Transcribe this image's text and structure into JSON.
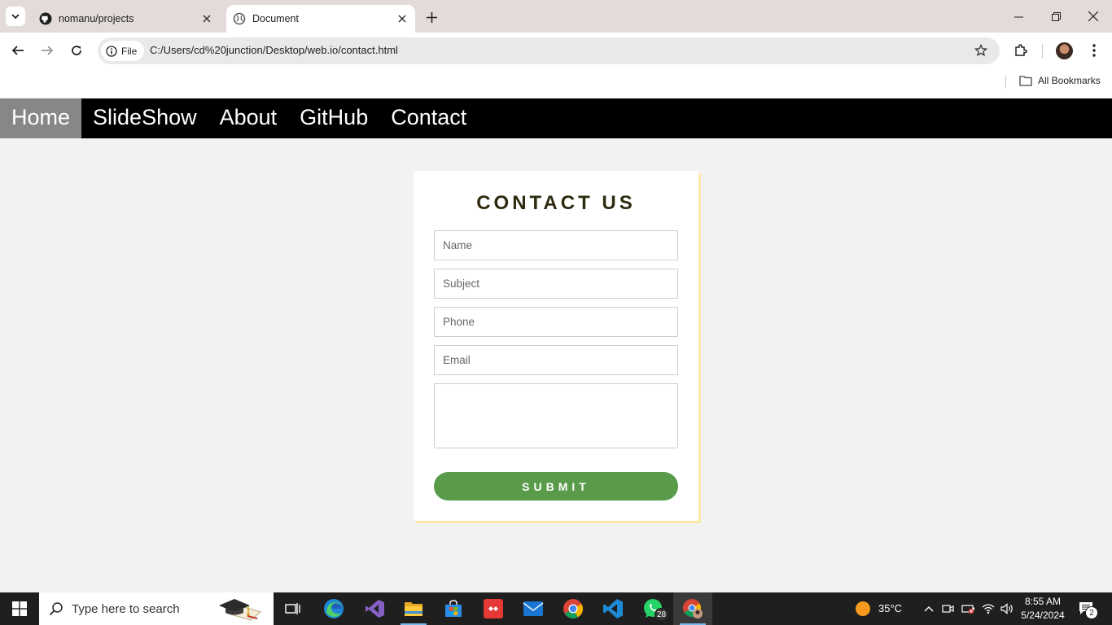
{
  "browser": {
    "tabs": [
      {
        "title": "nomanu/projects",
        "active": false
      },
      {
        "title": "Document",
        "active": true
      }
    ],
    "address": {
      "chip_label": "File",
      "url": "C:/Users/cd%20junction/Desktop/web.io/contact.html"
    },
    "bookmarks": {
      "all_label": "All Bookmarks"
    }
  },
  "site": {
    "nav": [
      {
        "label": "Home",
        "active": true
      },
      {
        "label": "SlideShow",
        "active": false
      },
      {
        "label": "About",
        "active": false
      },
      {
        "label": "GitHub",
        "active": false
      },
      {
        "label": "Contact",
        "active": false
      }
    ],
    "contact": {
      "title": "CONTACT US",
      "fields": {
        "name_placeholder": "Name",
        "subject_placeholder": "Subject",
        "phone_placeholder": "Phone",
        "email_placeholder": "Email",
        "message_value": ""
      },
      "submit_label": "SUBMIT"
    },
    "colors": {
      "nav_bg": "#000000",
      "nav_active": "#878787",
      "submit_bg": "#599b4b",
      "card_shadow": "#fbe9a8",
      "title_color": "#2e2a10"
    }
  },
  "taskbar": {
    "search_placeholder": "Type here to search",
    "apps": [
      {
        "icon": "task-view-icon"
      },
      {
        "icon": "edge-icon"
      },
      {
        "icon": "visual-studio-icon"
      },
      {
        "icon": "file-explorer-icon"
      },
      {
        "icon": "microsoft-store-icon"
      },
      {
        "icon": "anydesk-icon"
      },
      {
        "icon": "mail-icon"
      },
      {
        "icon": "chrome-icon"
      },
      {
        "icon": "vscode-icon"
      },
      {
        "icon": "whatsapp-icon",
        "badge": "28"
      },
      {
        "icon": "chrome-profile-icon"
      }
    ],
    "weather": {
      "temp": "35°C"
    },
    "clock": {
      "time": "8:55 AM",
      "date": "5/24/2024"
    },
    "notifications": {
      "count": "2"
    }
  }
}
